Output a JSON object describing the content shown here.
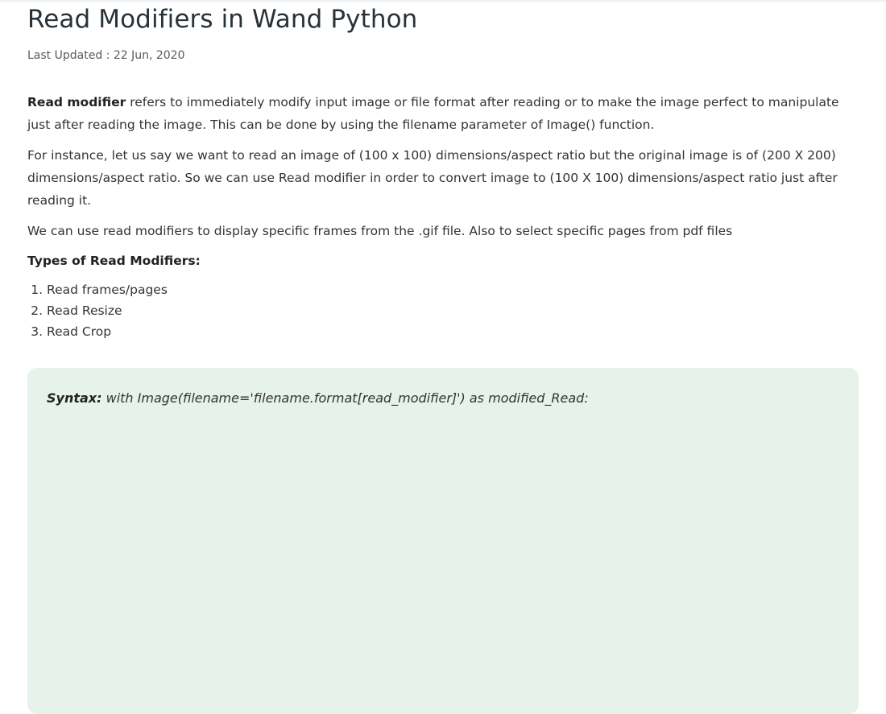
{
  "article": {
    "title": "Read Modifiers in Wand Python",
    "last_updated_label": "Last Updated : ",
    "last_updated_date": "22 Jun, 2020",
    "p1_bold": "Read modifier",
    "p1_rest": " refers to immediately modify input image or file format after reading or to make the image perfect to manipulate just after reading the image. This can be done by using the filename parameter of Image() function.",
    "p2": "For instance, let us say we want to read an image of (100 x 100) dimensions/aspect ratio but the original image is of (200 X 200) dimensions/aspect ratio. So we can use Read modifier in order to convert image to (100 X 100) dimensions/aspect ratio just after reading it.",
    "p3": "We can use read modifiers to display specific frames from the .gif file. Also to select specific pages from pdf files",
    "types_heading": "Types of Read Modifiers:",
    "types": [
      "Read frames/pages",
      "Read Resize",
      "Read Crop"
    ]
  },
  "syntax": {
    "label": "Syntax:",
    "code": " with Image(filename='filename.format[read_modifier]') as modified_Read:"
  },
  "colors": {
    "title": "#273239",
    "syntax_bg": "#e7f2ea"
  }
}
